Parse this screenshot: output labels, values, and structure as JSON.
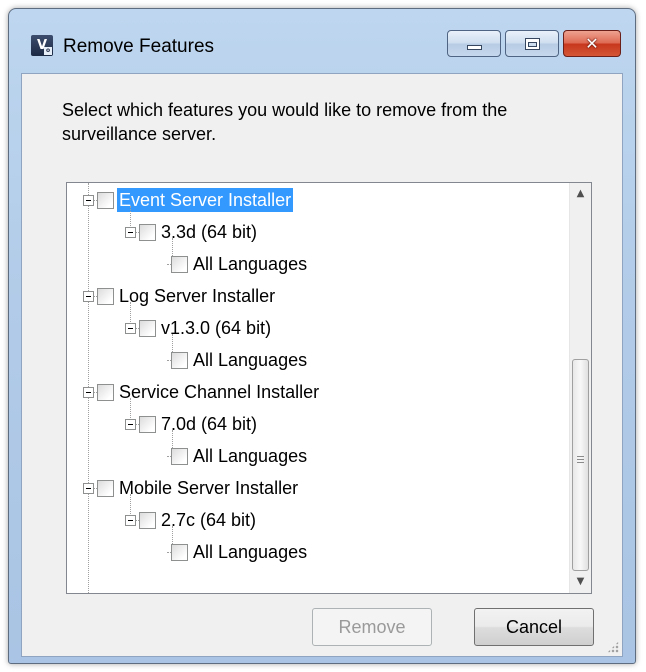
{
  "window": {
    "title": "Remove Features",
    "icon_name": "app-logo-icon",
    "close_glyph": "✕"
  },
  "instructions": "Select which features you would like to remove from the surveillance server.",
  "tree": [
    {
      "label": "Event Server Installer",
      "selected": true,
      "children": [
        {
          "label": "3.3d (64 bit)",
          "children": [
            {
              "label": "All Languages"
            }
          ]
        }
      ]
    },
    {
      "label": "Log Server Installer",
      "children": [
        {
          "label": "v1.3.0 (64 bit)",
          "children": [
            {
              "label": "All Languages"
            }
          ]
        }
      ]
    },
    {
      "label": "Service Channel Installer",
      "children": [
        {
          "label": "7.0d (64 bit)",
          "children": [
            {
              "label": "All Languages"
            }
          ]
        }
      ]
    },
    {
      "label": "Mobile Server Installer",
      "children": [
        {
          "label": "2.7c (64 bit)",
          "children": [
            {
              "label": "All Languages"
            }
          ]
        }
      ]
    }
  ],
  "buttons": {
    "remove_label": "Remove",
    "remove_enabled": false,
    "cancel_label": "Cancel"
  },
  "colors": {
    "selection": "#3399ff",
    "close_button": "#c7371d",
    "title_bar": "#b1cbe8"
  }
}
